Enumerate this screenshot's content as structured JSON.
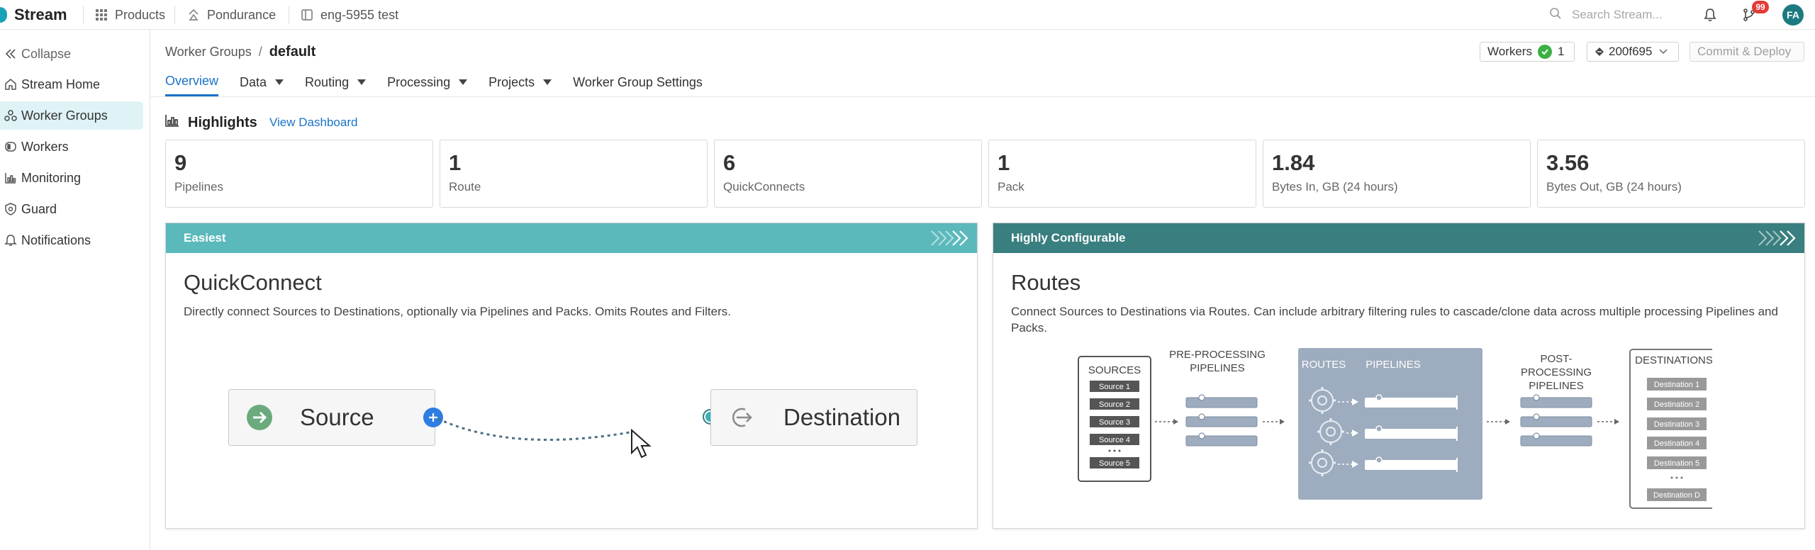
{
  "brand": {
    "name": "Stream"
  },
  "topnav": {
    "products": "Products",
    "org": "Pondurance",
    "workspace": "eng-5955 test"
  },
  "search": {
    "placeholder": "Search Stream..."
  },
  "notifications": {
    "badge": "99"
  },
  "user": {
    "initials": "FA"
  },
  "sidebar": {
    "collapse": "Collapse",
    "items": [
      {
        "label": "Stream Home",
        "icon": "home-icon"
      },
      {
        "label": "Worker Groups",
        "icon": "worker-groups-icon",
        "active": true
      },
      {
        "label": "Workers",
        "icon": "workers-icon"
      },
      {
        "label": "Monitoring",
        "icon": "monitoring-icon"
      },
      {
        "label": "Guard",
        "icon": "shield-icon"
      },
      {
        "label": "Notifications",
        "icon": "bell-icon"
      }
    ]
  },
  "breadcrumb": {
    "parent": "Worker Groups",
    "separator": "/",
    "current": "default"
  },
  "header": {
    "workers_label": "Workers",
    "workers_count": "1",
    "commit": "200f695",
    "deploy": "Commit & Deploy"
  },
  "tabs": [
    "Overview",
    "Data",
    "Routing",
    "Processing",
    "Projects",
    "Worker Group Settings"
  ],
  "highlights": {
    "title": "Highlights",
    "link": "View Dashboard",
    "stats": [
      {
        "value": "9",
        "label": "Pipelines"
      },
      {
        "value": "1",
        "label": "Route"
      },
      {
        "value": "6",
        "label": "QuickConnects"
      },
      {
        "value": "1",
        "label": "Pack"
      },
      {
        "value": "1.84",
        "label": "Bytes In, GB (24 hours)"
      },
      {
        "value": "3.56",
        "label": "Bytes Out, GB (24 hours)"
      }
    ]
  },
  "quickconnect": {
    "band": "Easiest",
    "title": "QuickConnect",
    "desc": "Directly connect Sources to Destinations, optionally via Pipelines and Packs. Omits Routes and Filters.",
    "source": "Source",
    "destination": "Destination"
  },
  "routes": {
    "band": "Highly Configurable",
    "title": "Routes",
    "desc": "Connect Sources to Destinations via Routes. Can include arbitrary filtering rules to cascade/clone data across multiple processing Pipelines and Packs.",
    "diagram": {
      "sources_title": "SOURCES",
      "sources": [
        "Source 1",
        "Source 2",
        "Source 3",
        "Source 4",
        "Source 5"
      ],
      "pre_label_1": "PRE-PROCESSING",
      "pre_label_2": "PIPELINES",
      "routes_label": "ROUTES",
      "pipelines_label": "PIPELINES",
      "post_label_1": "POST-",
      "post_label_2": "PROCESSING",
      "post_label_3": "PIPELINES",
      "destinations_title": "DESTINATIONS",
      "destinations": [
        "Destination 1",
        "Destination 2",
        "Destination 3",
        "Destination 4",
        "Destination 5",
        "Destination D"
      ]
    }
  },
  "colors": {
    "accent": "#1a73c7",
    "band_easy": "#5bb9bc",
    "band_config": "#3a7f80",
    "diagram_panel": "#9dacbe"
  }
}
